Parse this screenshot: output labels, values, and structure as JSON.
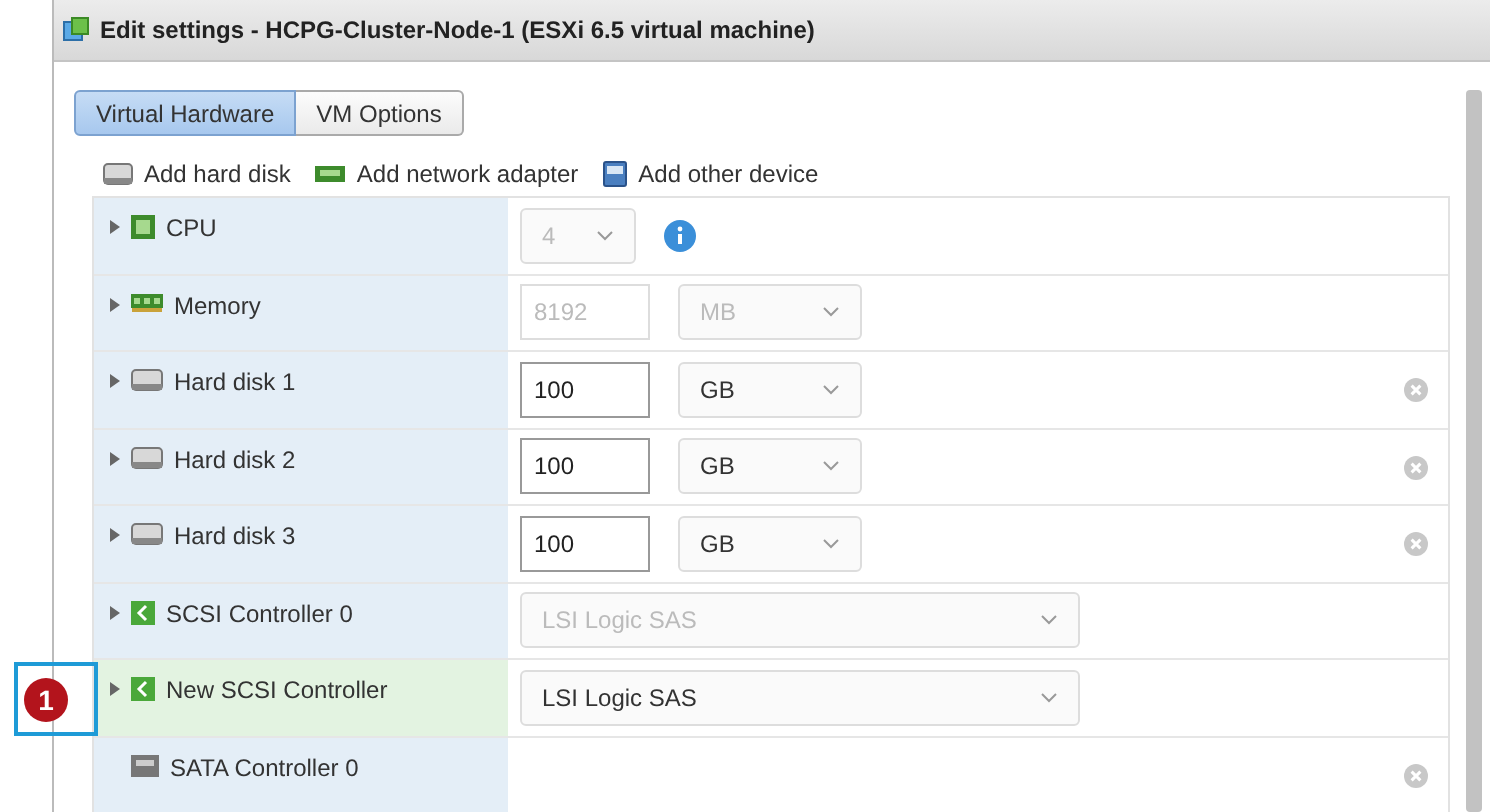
{
  "window": {
    "title": "Edit settings - HCPG-Cluster-Node-1 (ESXi 6.5 virtual machine)"
  },
  "tabs": [
    {
      "label": "Virtual Hardware",
      "selected": true
    },
    {
      "label": "VM Options",
      "selected": false
    }
  ],
  "toolbar": [
    {
      "label": "Add hard disk",
      "kind": "disk"
    },
    {
      "label": "Add network adapter",
      "kind": "network"
    },
    {
      "label": "Add other device",
      "kind": "device"
    }
  ],
  "rows": [
    {
      "label": "CPU",
      "kind": "cpu",
      "expandable": true,
      "new": false,
      "removable": false,
      "controls": [
        {
          "kind": "select",
          "value": "4",
          "disabled": true
        },
        {
          "kind": "info"
        }
      ]
    },
    {
      "label": "Memory",
      "kind": "memory",
      "expandable": true,
      "new": false,
      "removable": false,
      "controls": [
        {
          "kind": "input",
          "value": "8192",
          "disabled": true
        },
        {
          "kind": "select",
          "value": "MB",
          "disabled": true
        }
      ]
    },
    {
      "label": "Hard disk 1",
      "kind": "disk",
      "expandable": true,
      "new": false,
      "removable": true,
      "controls": [
        {
          "kind": "input",
          "value": "100",
          "disabled": false
        },
        {
          "kind": "select",
          "value": "GB",
          "disabled": false
        }
      ]
    },
    {
      "label": "Hard disk 2",
      "kind": "disk",
      "expandable": true,
      "new": false,
      "removable": true,
      "controls": [
        {
          "kind": "input",
          "value": "100",
          "disabled": false
        },
        {
          "kind": "select",
          "value": "GB",
          "disabled": false
        }
      ]
    },
    {
      "label": "Hard disk 3",
      "kind": "disk",
      "expandable": true,
      "new": false,
      "removable": true,
      "controls": [
        {
          "kind": "input",
          "value": "100",
          "disabled": false
        },
        {
          "kind": "select",
          "value": "GB",
          "disabled": false
        }
      ]
    },
    {
      "label": "SCSI Controller 0",
      "kind": "scsi",
      "expandable": true,
      "new": false,
      "removable": false,
      "controls": [
        {
          "kind": "wide-select",
          "value": "LSI Logic SAS",
          "disabled": true
        }
      ]
    },
    {
      "label": "New SCSI Controller",
      "kind": "scsi",
      "expandable": true,
      "new": true,
      "removable": false,
      "callout": "1",
      "controls": [
        {
          "kind": "wide-select",
          "value": "LSI Logic SAS",
          "disabled": false
        }
      ]
    },
    {
      "label": "SATA Controller 0",
      "kind": "sata",
      "expandable": false,
      "new": false,
      "removable": true,
      "controls": []
    }
  ]
}
